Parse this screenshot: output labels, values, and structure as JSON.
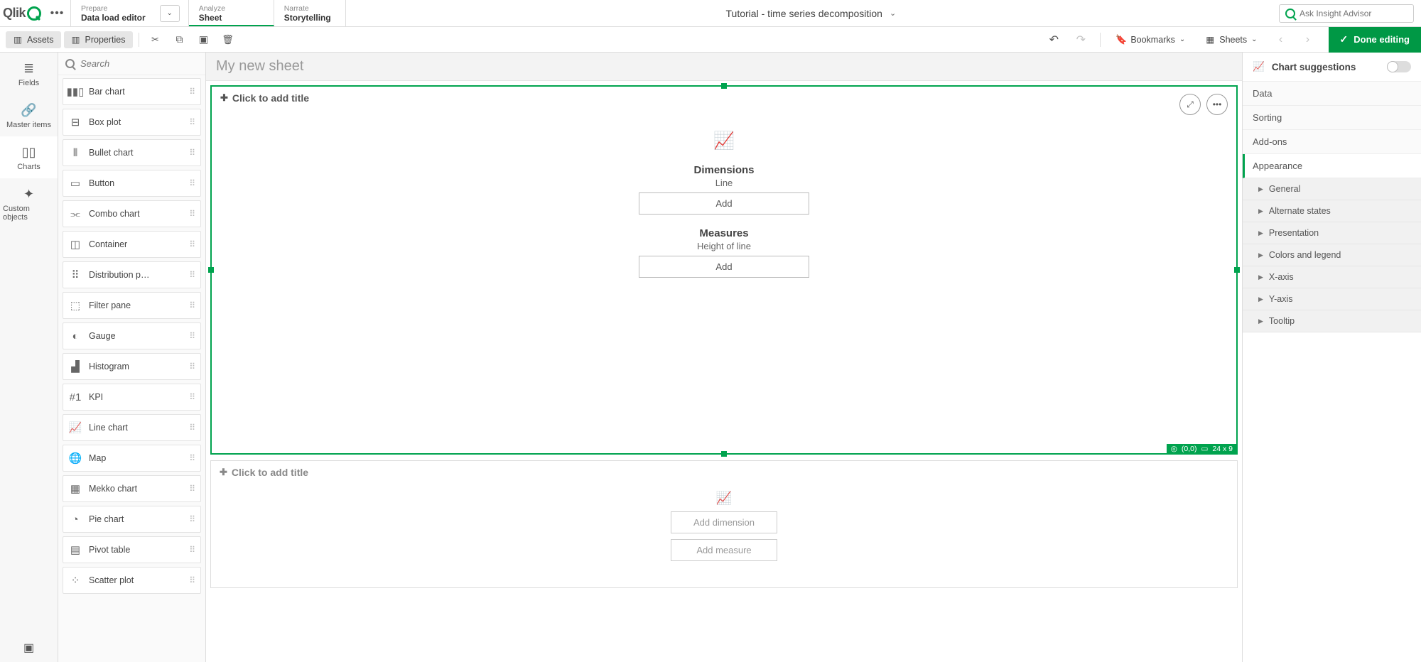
{
  "header": {
    "logo_text": "Qlik",
    "nav": {
      "prepare": {
        "eyebrow": "Prepare",
        "label": "Data load editor"
      },
      "analyze": {
        "eyebrow": "Analyze",
        "label": "Sheet"
      },
      "narrate": {
        "eyebrow": "Narrate",
        "label": "Storytelling"
      }
    },
    "title": "Tutorial - time series decomposition",
    "search_placeholder": "Ask Insight Advisor"
  },
  "toolbar": {
    "assets": "Assets",
    "properties": "Properties",
    "bookmarks": "Bookmarks",
    "sheets": "Sheets",
    "done": "Done editing"
  },
  "rail": {
    "fields": "Fields",
    "master": "Master items",
    "charts": "Charts",
    "custom": "Custom objects"
  },
  "assets": {
    "search_placeholder": "Search",
    "items": [
      {
        "icon": "▮▮▯",
        "label": "Bar chart"
      },
      {
        "icon": "⊟",
        "label": "Box plot"
      },
      {
        "icon": "⦀",
        "label": "Bullet chart"
      },
      {
        "icon": "▭",
        "label": "Button"
      },
      {
        "icon": "⫘",
        "label": "Combo chart"
      },
      {
        "icon": "◫",
        "label": "Container"
      },
      {
        "icon": "⠿",
        "label": "Distribution p…"
      },
      {
        "icon": "⬚",
        "label": "Filter pane"
      },
      {
        "icon": "◐",
        "label": "Gauge"
      },
      {
        "icon": "▟",
        "label": "Histogram"
      },
      {
        "icon": "#1",
        "label": "KPI"
      },
      {
        "icon": "📈",
        "label": "Line chart"
      },
      {
        "icon": "🌐",
        "label": "Map"
      },
      {
        "icon": "▦",
        "label": "Mekko chart"
      },
      {
        "icon": "◔",
        "label": "Pie chart"
      },
      {
        "icon": "▤",
        "label": "Pivot table"
      },
      {
        "icon": "⁘",
        "label": "Scatter plot"
      }
    ]
  },
  "canvas": {
    "sheet_title": "My new sheet",
    "box1": {
      "title": "Click to add title",
      "dimensions_label": "Dimensions",
      "dimensions_sub": "Line",
      "dim_add": "Add",
      "measures_label": "Measures",
      "measures_sub": "Height of line",
      "meas_add": "Add",
      "pos": "(0,0)",
      "size": "24 x 9"
    },
    "box2": {
      "title": "Click to add title",
      "add_dim": "Add dimension",
      "add_meas": "Add measure"
    }
  },
  "props": {
    "suggestions": "Chart suggestions",
    "sections": [
      {
        "label": "Data"
      },
      {
        "label": "Sorting"
      },
      {
        "label": "Add-ons"
      },
      {
        "label": "Appearance",
        "active": true
      }
    ],
    "appearance_subs": [
      "General",
      "Alternate states",
      "Presentation",
      "Colors and legend",
      "X-axis",
      "Y-axis",
      "Tooltip"
    ]
  }
}
